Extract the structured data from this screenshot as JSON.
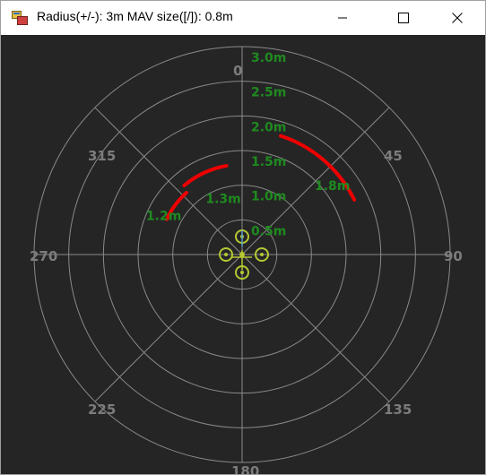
{
  "window": {
    "title": "Radius(+/-): 3m MAV size([/]): 0.8m",
    "buttons": {
      "minimize": "minimize-icon",
      "maximize": "maximize-icon",
      "close": "close-icon"
    }
  },
  "radar": {
    "max_radius_m": 3.0,
    "ring_step_m": 0.5,
    "ring_labels": [
      "0.5m",
      "1.0m",
      "1.5m",
      "2.0m",
      "2.5m",
      "3.0m"
    ],
    "angle_labels": [
      "0",
      "45",
      "90",
      "135",
      "180",
      "225",
      "270",
      "315"
    ],
    "colors": {
      "background": "#252526",
      "grid": "#8a8a8a",
      "angle_text": "#7c7c7c",
      "range_text": "#1f8a1f",
      "obstacle": "#ee0000",
      "vehicle": "#b5c832"
    },
    "obstacles": [
      {
        "label": "1.2m",
        "distance_m": 1.2,
        "start_deg": 295,
        "end_deg": 318
      },
      {
        "label": "1.3m",
        "distance_m": 1.3,
        "start_deg": 320,
        "end_deg": 350
      },
      {
        "label": "1.8m",
        "distance_m": 1.8,
        "start_deg": 18,
        "end_deg": 64
      }
    ]
  }
}
